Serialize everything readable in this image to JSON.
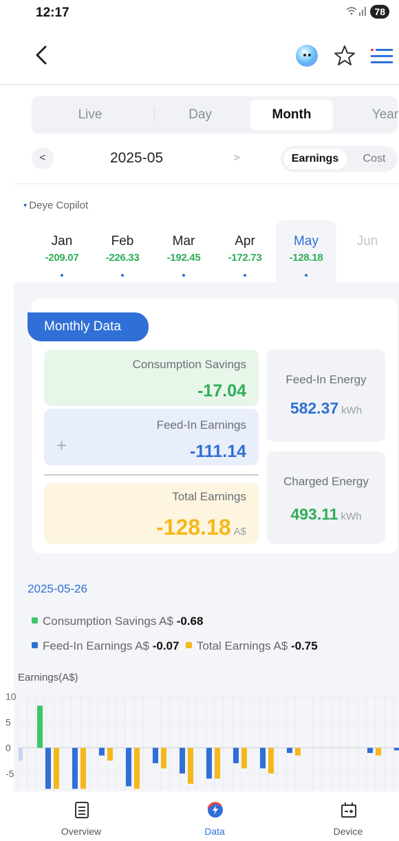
{
  "status_bar": {
    "time": "12:17",
    "battery": "78"
  },
  "tabs": {
    "live": "Live",
    "day": "Day",
    "month": "Month",
    "year": "Year",
    "active": "Month"
  },
  "date_nav": {
    "prev": "<",
    "date": "2025-05",
    "next": ">"
  },
  "toggle": {
    "earnings": "Earnings",
    "cost": "Cost",
    "active": "Earnings"
  },
  "copilot_tag": "Deye Copilot",
  "months": [
    {
      "name": "Jan",
      "value": "-209.07"
    },
    {
      "name": "Feb",
      "value": "-226.33"
    },
    {
      "name": "Mar",
      "value": "-192.45"
    },
    {
      "name": "Apr",
      "value": "-172.73"
    },
    {
      "name": "May",
      "value": "-128.18"
    },
    {
      "name": "Jun",
      "value": ""
    }
  ],
  "monthly_data": {
    "title": "Monthly Data",
    "consumption_savings_label": "Consumption Savings",
    "consumption_savings_value": "-17.04",
    "feed_in_earnings_label": "Feed-In Earnings",
    "feed_in_earnings_value": "-111.14",
    "plus_symbol": "+",
    "total_earnings_label": "Total Earnings",
    "total_earnings_value": "-128.18",
    "total_unit": "A$",
    "feed_in_energy_label": "Feed-In Energy",
    "feed_in_energy_value": "582.37",
    "charged_energy_label": "Charged Energy",
    "charged_energy_value": "493.11",
    "energy_unit": "kWh"
  },
  "day_detail": {
    "date": "2025-05-26",
    "consumption_savings_label": "Consumption Savings A$",
    "consumption_savings_value": "-0.68",
    "feed_in_label": "Feed-In Earnings A$",
    "feed_in_value": "-0.07",
    "total_label": "Total Earnings A$",
    "total_value": "-0.75"
  },
  "colors": {
    "accent": "#2f6fd6",
    "consumption": "#3cc56b",
    "feed_in": "#2f6fd6",
    "total": "#f5b81c",
    "positive_green": "#2fae58"
  },
  "chart_data": {
    "type": "bar",
    "ylabel": "Earnings(A$)",
    "y_ticks": [
      10,
      5,
      0,
      -5
    ],
    "ylim": [
      -8.5,
      10
    ],
    "grid": true,
    "series": [
      {
        "name": "Consumption Savings",
        "values": [
          8.2,
          0,
          0,
          0,
          0,
          0,
          0,
          0,
          0,
          0,
          0,
          0,
          0,
          0,
          0.7,
          -0.5,
          0,
          0.5,
          0,
          -0.7,
          -0.5,
          0
        ]
      },
      {
        "name": "Feed-In Earnings",
        "values": [
          -8,
          -8,
          -1.5,
          -7.5,
          -3,
          -5,
          -6,
          -3,
          -4,
          -1,
          0,
          0,
          -1,
          -0.5,
          -0.6,
          0,
          -0.6,
          -0.5,
          -0.6,
          0,
          0,
          0
        ]
      },
      {
        "name": "Total Earnings",
        "values": [
          -8,
          -8,
          -2.5,
          -8,
          -4,
          -7,
          -6,
          -4,
          -5,
          -1.5,
          0,
          0,
          -1.5,
          -1,
          -0.7,
          -0.7,
          -2,
          -1,
          -1.5,
          -0.6,
          -0.7,
          0
        ]
      }
    ]
  },
  "bottom_nav": {
    "overview": "Overview",
    "data": "Data",
    "device": "Device",
    "active": "Data"
  }
}
